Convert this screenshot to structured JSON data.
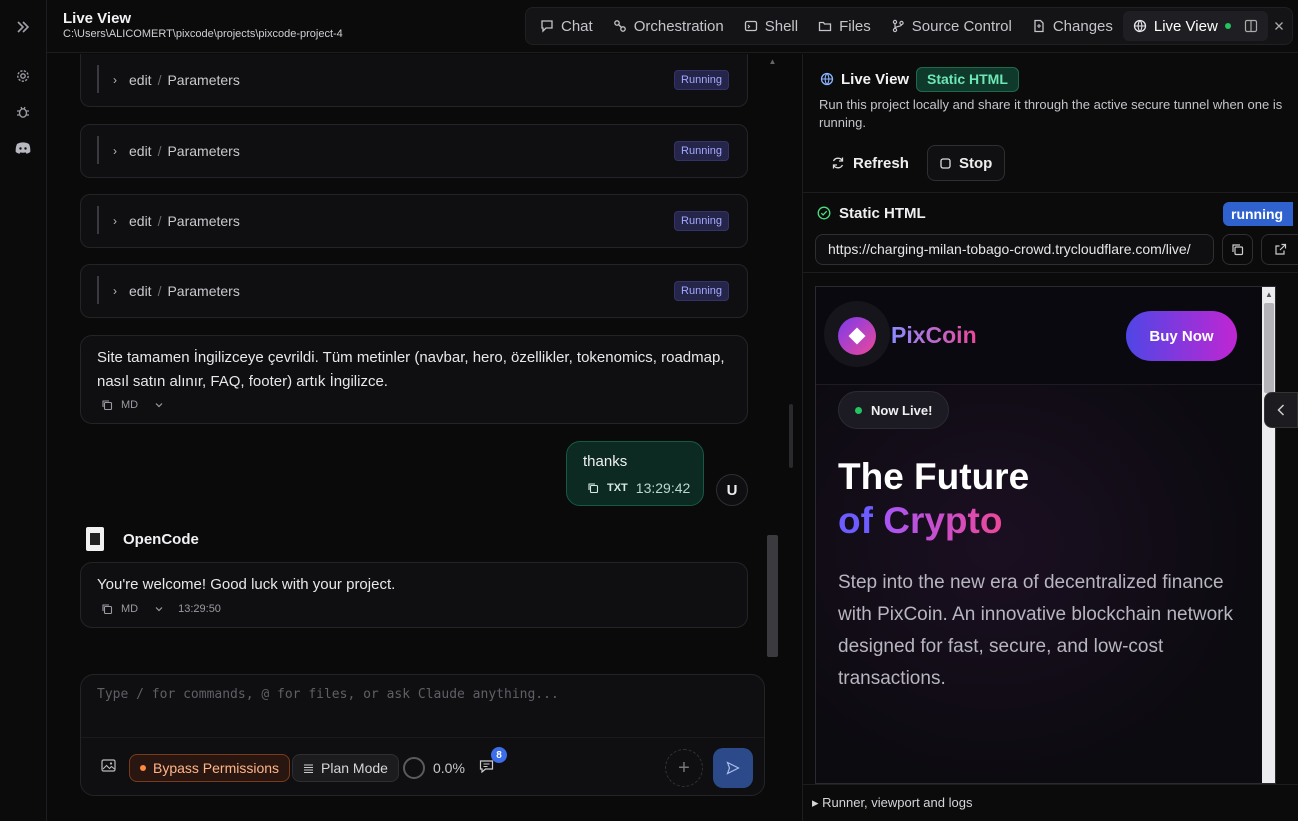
{
  "header": {
    "title": "Live View",
    "path": "C:\\Users\\ALICOMERT\\pixcode\\projects\\pixcode-project-4"
  },
  "tabs": [
    {
      "label": "Chat",
      "icon": "chat-icon"
    },
    {
      "label": "Orchestration",
      "icon": "orchestration-icon"
    },
    {
      "label": "Shell",
      "icon": "shell-icon"
    },
    {
      "label": "Files",
      "icon": "folder-icon"
    },
    {
      "label": "Source Control",
      "icon": "git-branch-icon"
    },
    {
      "label": "Changes",
      "icon": "file-diff-icon"
    },
    {
      "label": "Live View",
      "icon": "globe-icon",
      "active": true
    }
  ],
  "chat": {
    "tool_calls": [
      {
        "action": "edit",
        "sep": "/",
        "target": "Parameters",
        "status": "Running"
      },
      {
        "action": "edit",
        "sep": "/",
        "target": "Parameters",
        "status": "Running"
      },
      {
        "action": "edit",
        "sep": "/",
        "target": "Parameters",
        "status": "Running"
      },
      {
        "action": "edit",
        "sep": "/",
        "target": "Parameters",
        "status": "Running"
      }
    ],
    "assistant_msg_1": {
      "text": "Site tamamen İngilizceye çevrildi. Tüm metinler (navbar, hero, özellikler, tokenomics, roadmap, nasıl satın alınır, FAQ, footer) artık İngilizce.",
      "format": "MD"
    },
    "user_msg": {
      "text": "thanks",
      "format": "TXT",
      "time": "13:29:42",
      "avatar": "U"
    },
    "agent_name": "OpenCode",
    "assistant_msg_2": {
      "text": "You're welcome! Good luck with your project.",
      "format": "MD",
      "time": "13:29:50"
    }
  },
  "composer": {
    "placeholder": "Type / for commands, @ for files, or ask Claude anything...",
    "bypass_label": "Bypass Permissions",
    "plan_label": "Plan Mode",
    "context_pct": "0.0%",
    "queue_count": "8",
    "plus": "+"
  },
  "panel": {
    "title": "Live View",
    "tag": "Static HTML",
    "description": "Run this project locally and share it through the active secure tunnel when one is running.",
    "refresh_label": "Refresh",
    "stop_label": "Stop",
    "server_name": "Static HTML",
    "server_status": "running",
    "url": "https://charging-milan-tobago-crowd.trycloudflare.com/live/",
    "runner_label": "Runner, viewport and logs"
  },
  "preview": {
    "brand": "PixCoin",
    "buy_label": "Buy Now",
    "live_badge": "Now Live!",
    "headline_1": "The Future",
    "headline_2a": "of",
    "headline_2b": "Crypto",
    "body": "Step into the new era of decentralized finance with PixCoin. An innovative blockchain network designed for fast, secure, and low-cost transactions."
  },
  "colors": {
    "accent_blue": "#2f62cf",
    "running_badge": "#a5a8ff",
    "success_green": "#22c55e",
    "bypass_orange": "#ff8a3d"
  }
}
